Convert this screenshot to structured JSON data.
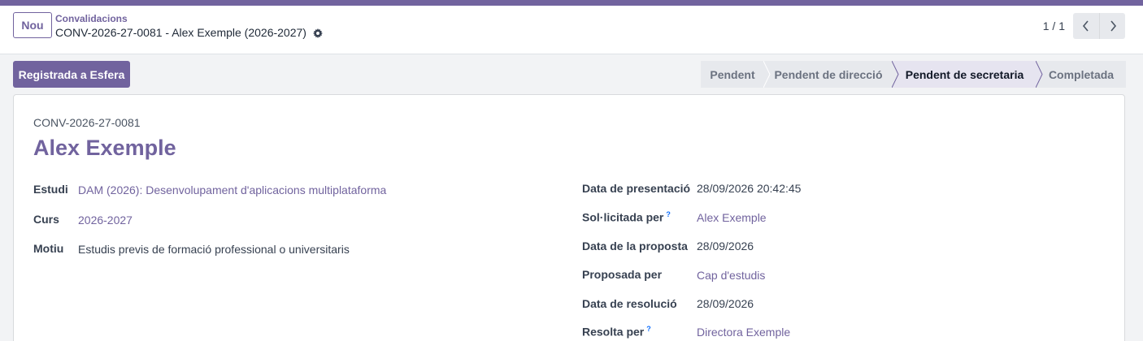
{
  "header": {
    "new_label": "Nou",
    "breadcrumb": "Convalidacions",
    "record_title": "CONV-2026-27-0081 - Alex Exemple (2026-2027)",
    "pager_value": "1 / 1"
  },
  "actions": {
    "primary_label": "Registrada a Esfera"
  },
  "status": {
    "stages": [
      "Pendent",
      "Pendent de direcció",
      "Pendent de secretaria",
      "Completada"
    ],
    "current_index": 2
  },
  "form": {
    "reference": "CONV-2026-27-0081",
    "name": "Alex Exemple",
    "left": [
      {
        "label": "Estudi",
        "value": "DAM (2026): Desenvolupament d'aplicacions multiplataforma"
      },
      {
        "label": "Curs",
        "value": "2026-2027"
      },
      {
        "label": "Motiu",
        "value": "Estudis previs de formació professional o universitaris"
      }
    ],
    "right": [
      {
        "label": "Data de presentació",
        "value": "28/09/2026 20:42:45"
      },
      {
        "label": "Sol·licitada per",
        "help": "?",
        "value": "Alex Exemple"
      },
      {
        "label": "Data de la proposta",
        "value": "28/09/2026"
      },
      {
        "label": "Proposada per",
        "value": "Cap d'estudis"
      },
      {
        "label": "Data de resolució",
        "value": "28/09/2026"
      },
      {
        "label": "Resolta per",
        "help": "?",
        "value": "Directora Exemple"
      }
    ]
  },
  "colors": {
    "brand": "#71639e",
    "help": "#0d6efd"
  }
}
